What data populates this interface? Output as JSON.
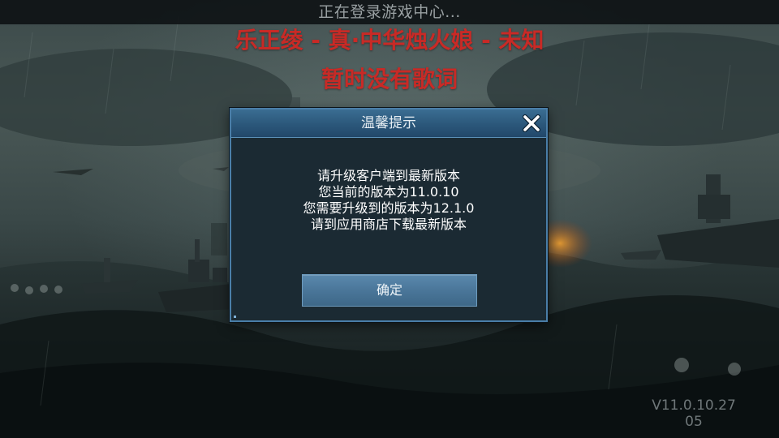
{
  "status_banner": {
    "text": "正在登录游戏中心..."
  },
  "lyrics": {
    "line1": "乐正绫 - 真·中华烛火娘 - 未知",
    "line2": "暂时没有歌词"
  },
  "version": {
    "line1": "V11.0.10.27",
    "line2": "05"
  },
  "dialog": {
    "title": "温馨提示",
    "close_icon": "close-x-icon",
    "message_lines": [
      "请升级客户端到最新版本",
      "您当前的版本为11.0.10",
      "您需要升级到的版本为12.1.0",
      "请到应用商店下载最新版本"
    ],
    "confirm_label": "确定"
  },
  "colors": {
    "lyric_red": "#c82a26",
    "dialog_border": "#4a7ea8",
    "dialog_bg": "#1b2a33",
    "header_blue": "#2b577a",
    "button_blue": "#4a7699"
  }
}
